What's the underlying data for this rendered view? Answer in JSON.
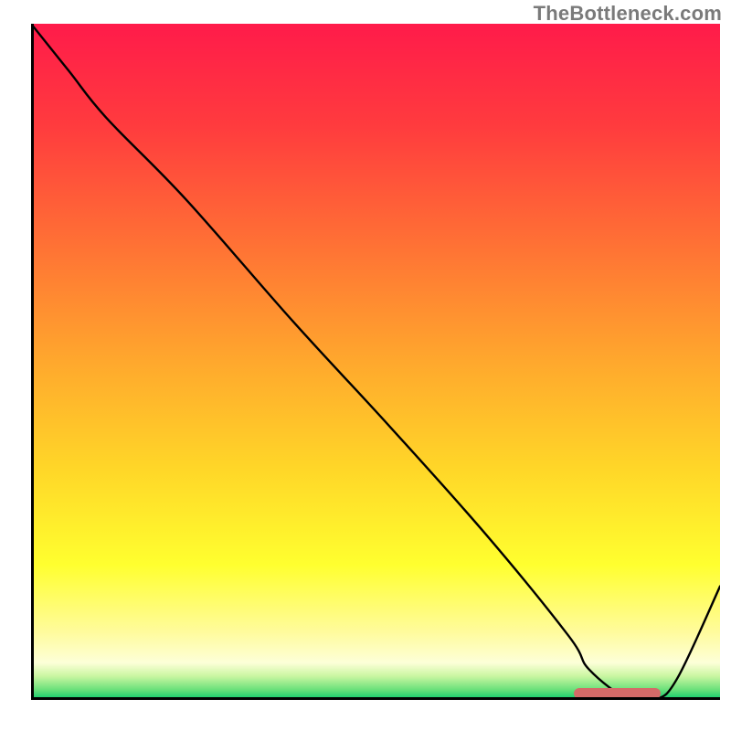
{
  "watermark": "TheBottleneck.com",
  "chart_data": {
    "type": "line",
    "title": "",
    "xlabel": "",
    "ylabel": "",
    "xlim": [
      0,
      100
    ],
    "ylim": [
      0,
      100
    ],
    "grid": false,
    "series": [
      {
        "name": "bottleneck-curve",
        "x": [
          0,
          5.5,
          11,
          22.5,
          38,
          52,
          66,
          78,
          81,
          86.8,
          90.5,
          93.8,
          100
        ],
        "y": [
          100,
          93,
          86,
          74,
          56,
          40.5,
          24.5,
          9.5,
          4.5,
          0,
          0,
          3.2,
          16.8
        ]
      }
    ],
    "gradient_stops": [
      {
        "offset": 0.0,
        "color": "#ff1b4a"
      },
      {
        "offset": 0.15,
        "color": "#ff3b3e"
      },
      {
        "offset": 0.32,
        "color": "#ff6f35"
      },
      {
        "offset": 0.5,
        "color": "#ffa82d"
      },
      {
        "offset": 0.66,
        "color": "#ffd728"
      },
      {
        "offset": 0.8,
        "color": "#ffff2f"
      },
      {
        "offset": 0.9,
        "color": "#fffb9d"
      },
      {
        "offset": 0.945,
        "color": "#fdffd8"
      },
      {
        "offset": 0.965,
        "color": "#c9f6a1"
      },
      {
        "offset": 0.985,
        "color": "#69e07a"
      },
      {
        "offset": 1.0,
        "color": "#07c86c"
      }
    ],
    "marker": {
      "name": "optimal-range",
      "x_start": 78.8,
      "x_end": 91.4,
      "y": 1.0,
      "color": "#d46a68"
    }
  }
}
